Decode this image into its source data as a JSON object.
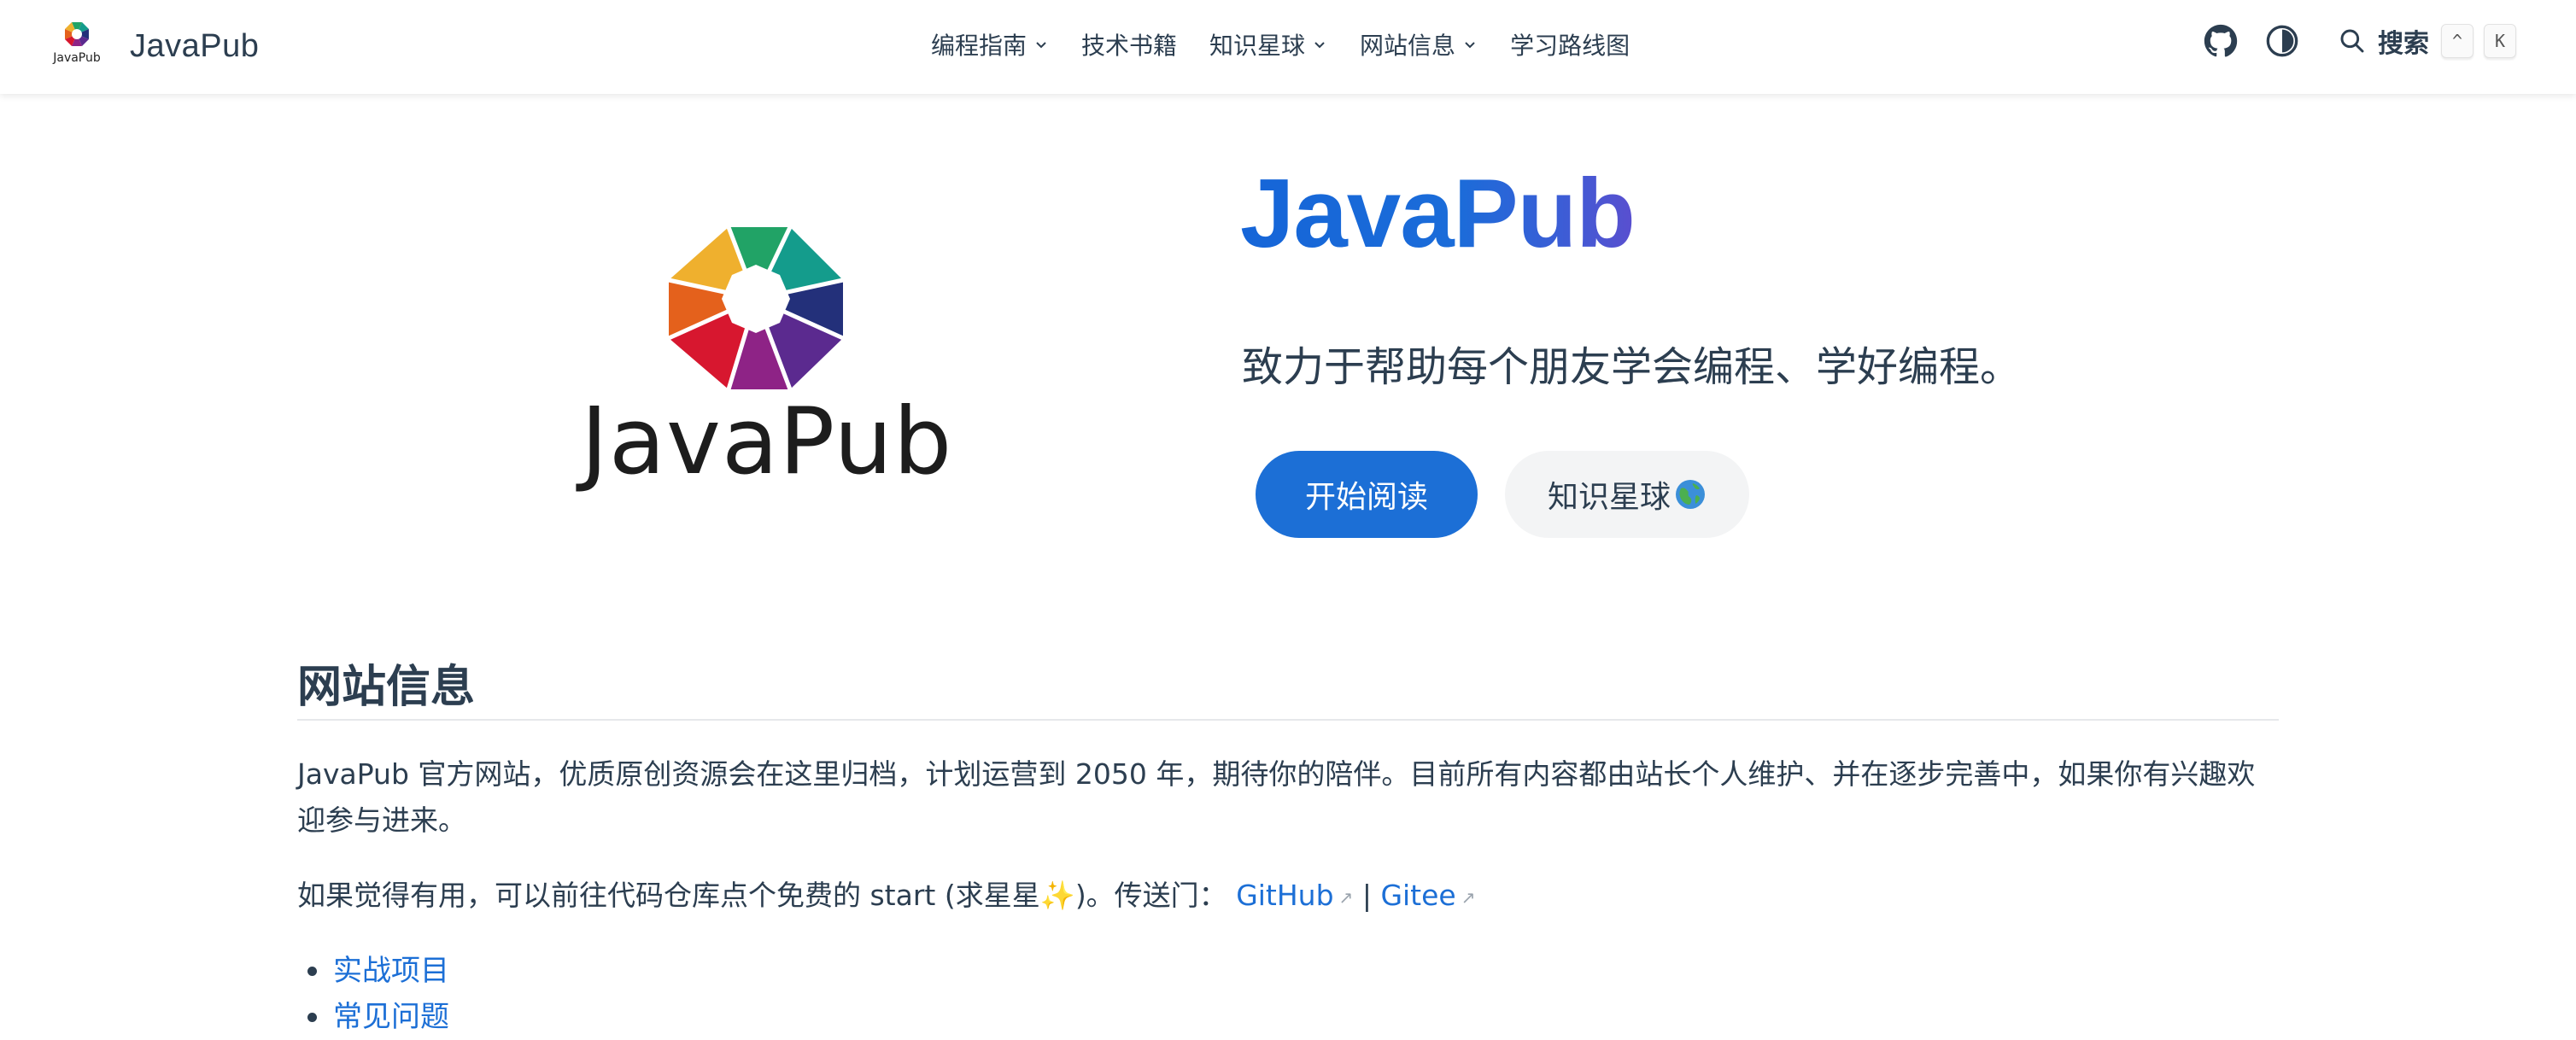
{
  "brand": {
    "logo_caption": "JavaPub",
    "name": "JavaPub"
  },
  "nav": {
    "items": [
      {
        "label": "编程指南",
        "has_dropdown": true
      },
      {
        "label": "技术书籍",
        "has_dropdown": false
      },
      {
        "label": "知识星球",
        "has_dropdown": true
      },
      {
        "label": "网站信息",
        "has_dropdown": true
      },
      {
        "label": "学习路线图",
        "has_dropdown": false
      }
    ],
    "icons": [
      "github-icon",
      "theme-toggle-icon",
      "search-icon"
    ],
    "search_label": "搜索",
    "shortcut_keys": [
      "^",
      "K"
    ]
  },
  "hero": {
    "logo_text": "JavaPub",
    "title": "JavaPub",
    "tagline": "致力于帮助每个朋友学会编程、学好编程。",
    "primary_button": "开始阅读",
    "secondary_button": "知识星球",
    "secondary_button_emoji": "globe-icon"
  },
  "content": {
    "section_title": "网站信息",
    "para1": "JavaPub 官方网站，优质原创资源会在这里归档，计划运营到 2050 年，期待你的陪伴。目前所有内容都由站长个人维护、并在逐步完善中，如果你有兴趣欢迎参与进来。",
    "para2_prefix": "如果觉得有用，可以前往代码仓库点个免费的 start (求星星",
    "para2_sparkle": "✨",
    "para2_suffix": ")。传送门：",
    "link_github": "GitHub",
    "separator": "|",
    "link_gitee": "Gitee",
    "list": [
      "实战项目",
      "常见问题"
    ]
  },
  "colors": {
    "accent": "#1c6fd6",
    "text": "#2c3e50",
    "button_secondary_bg": "#f3f4f5"
  }
}
